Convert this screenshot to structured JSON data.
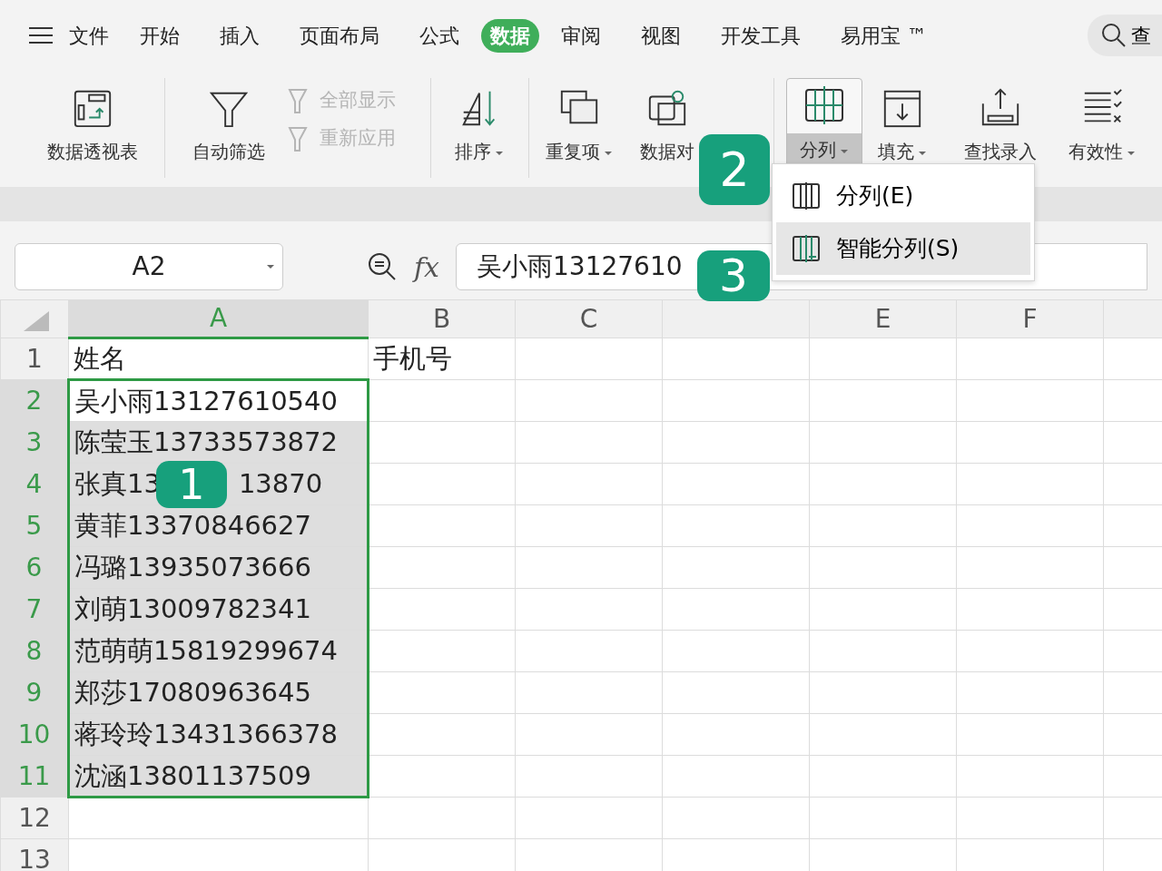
{
  "menu_tabs": [
    {
      "label": "文件",
      "selected": false
    },
    {
      "label": "开始",
      "selected": false
    },
    {
      "label": "插入",
      "selected": false
    },
    {
      "label": "页面布局",
      "selected": false
    },
    {
      "label": "公式",
      "selected": false
    },
    {
      "label": "数据",
      "selected": true
    },
    {
      "label": "审阅",
      "selected": false
    },
    {
      "label": "视图",
      "selected": false
    },
    {
      "label": "开发工具",
      "selected": false
    },
    {
      "label": "易用宝 ™",
      "selected": false
    }
  ],
  "search": {
    "label": "查"
  },
  "ribbon": [
    {
      "kind": "large",
      "label": "数据透视表",
      "dropdown": false,
      "pressed": false
    },
    {
      "kind": "separator"
    },
    {
      "kind": "large",
      "label": "自动筛选",
      "dropdown": false,
      "pressed": false
    },
    {
      "kind": "small",
      "items": [
        {
          "label": "全部显示",
          "disabled": true
        },
        {
          "label": "重新应用",
          "disabled": true
        }
      ]
    },
    {
      "kind": "separator"
    },
    {
      "kind": "large",
      "label": "排序",
      "dropdown": true,
      "pressed": false
    },
    {
      "kind": "separator"
    },
    {
      "kind": "large",
      "label": "重复项",
      "dropdown": true,
      "pressed": false
    },
    {
      "kind": "large",
      "label": "数据对",
      "dropdown": false,
      "pressed": false
    },
    {
      "kind": "separator"
    },
    {
      "kind": "large",
      "label": "分列",
      "dropdown": true,
      "pressed": true
    },
    {
      "kind": "large",
      "label": "填充",
      "dropdown": true,
      "pressed": false
    },
    {
      "kind": "large",
      "label": "查找录入",
      "dropdown": false,
      "pressed": false
    },
    {
      "kind": "large",
      "label": "有效性",
      "dropdown": true,
      "pressed": false
    }
  ],
  "dropdown_menu": [
    {
      "label": "分列(E)",
      "selected": false
    },
    {
      "label": "智能分列(S)",
      "selected": true
    }
  ],
  "name_box": "A2",
  "fx_label": "fx",
  "formula": "吴小雨13127610",
  "columns": [
    {
      "label": "A",
      "selected": true
    },
    {
      "label": "B",
      "selected": false
    },
    {
      "label": "C",
      "selected": false
    },
    {
      "selected": false
    },
    {
      "label": "E",
      "selected": false
    },
    {
      "label": "F",
      "selected": false
    }
  ],
  "rows": [
    {
      "number": "1",
      "selected": false,
      "a": [
        "姓名"
      ],
      "b": "手机号"
    },
    {
      "number": "2",
      "selected": true,
      "active": true,
      "a": [
        "吴小雨13127610540"
      ]
    },
    {
      "number": "3",
      "selected": true,
      "active": false,
      "a": [
        "陈莹玉13733573872"
      ]
    },
    {
      "number": "4",
      "selected": true,
      "active": false,
      "a": [
        "张真13",
        "13870"
      ]
    },
    {
      "number": "5",
      "selected": true,
      "active": false,
      "a": [
        "黄菲13370846627"
      ]
    },
    {
      "number": "6",
      "selected": true,
      "active": false,
      "a": [
        "冯璐13935073666"
      ]
    },
    {
      "number": "7",
      "selected": true,
      "active": false,
      "a": [
        "刘萌13009782341"
      ]
    },
    {
      "number": "8",
      "selected": true,
      "active": false,
      "a": [
        "范萌萌15819299674"
      ]
    },
    {
      "number": "9",
      "selected": true,
      "active": false,
      "a": [
        "郑莎17080963645"
      ]
    },
    {
      "number": "10",
      "selected": true,
      "active": false,
      "a": [
        "蒋玲玲13431366378"
      ]
    },
    {
      "number": "11",
      "selected": true,
      "active": false,
      "a": [
        "沈涵13801137509"
      ]
    },
    {
      "number": "12",
      "selected": false,
      "a": []
    },
    {
      "number": "13",
      "selected": false,
      "a": []
    }
  ],
  "callouts": [
    {
      "label": "1"
    },
    {
      "label": "2"
    },
    {
      "label": "3"
    }
  ]
}
